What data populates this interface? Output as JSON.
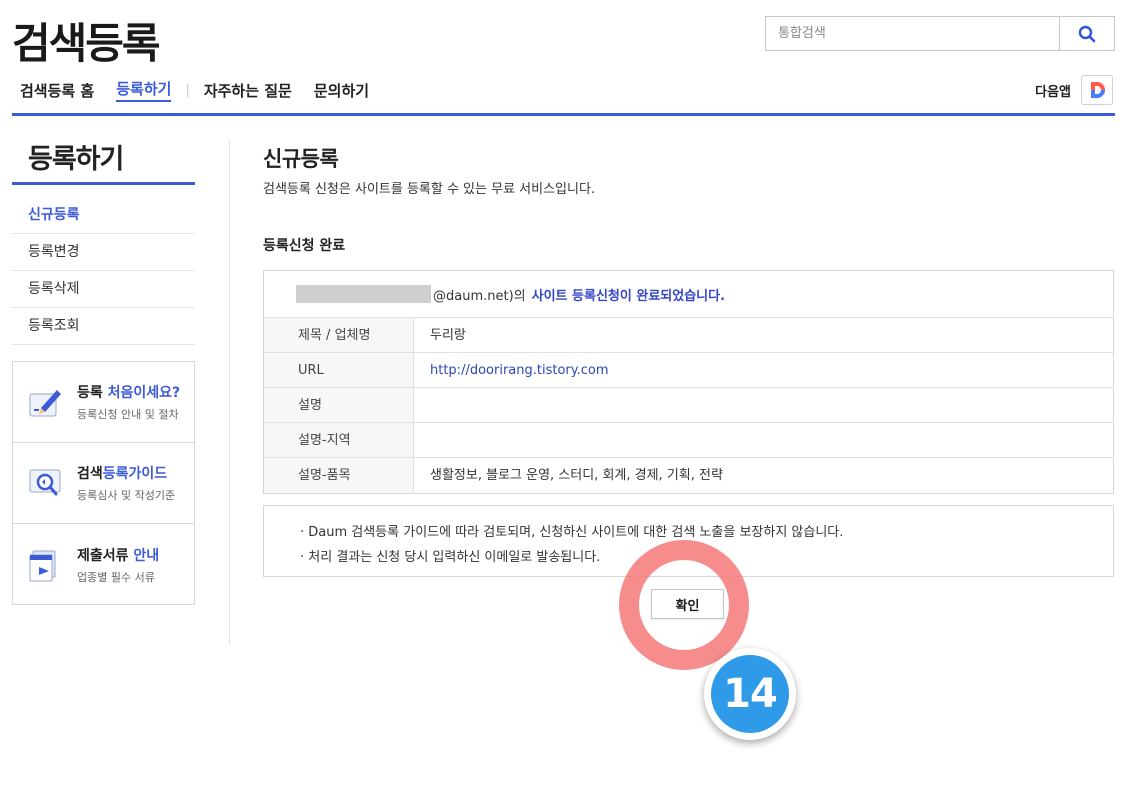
{
  "header": {
    "logo": "검색등록",
    "search_placeholder": "통합검색"
  },
  "topnav": {
    "home": "검색등록 홈",
    "register": "등록하기",
    "faq": "자주하는 질문",
    "contact": "문의하기",
    "daum_app": "다음앱"
  },
  "sidebar": {
    "title": "등록하기",
    "items": [
      {
        "label": "신규등록"
      },
      {
        "label": "등록변경"
      },
      {
        "label": "등록삭제"
      },
      {
        "label": "등록조회"
      }
    ],
    "cards": [
      {
        "title_a": "등록 ",
        "title_b": "처음이세요?",
        "sub": "등록신청 안내 및 절차",
        "icon": "pencil-icon"
      },
      {
        "title_a": "검색",
        "title_b": "등록가이드",
        "sub": "등록심사 및 작성기준",
        "icon": "magnifier-guide-icon"
      },
      {
        "title_a": "제출서류 ",
        "title_b": "안내",
        "sub": "업종별 필수 서류",
        "icon": "documents-icon"
      }
    ]
  },
  "main": {
    "title": "신규등록",
    "desc": "검색등록 신청은 사이트를 등록할 수 있는 무료 서비스입니다.",
    "section_title": "등록신청 완료",
    "result_email_suffix": "@daum.net)의",
    "result_done": "사이트 등록신청이 완료되었습니다.",
    "rows": [
      {
        "label": "제목 / 업체명",
        "value": "두리랑"
      },
      {
        "label": "URL",
        "value": "http://doorirang.tistory.com"
      },
      {
        "label": "설명",
        "value": ""
      },
      {
        "label": "설명-지역",
        "value": ""
      },
      {
        "label": "설명-품목",
        "value": "생활정보, 블로그 운영, 스터디, 회계, 경제, 기획, 전략"
      }
    ],
    "notices": [
      "· Daum 검색등록 가이드에 따라 검토되며, 신청하신 사이트에 대한 검색 노출을 보장하지 않습니다.",
      "· 처리 결과는 신청 당시 입력하신 이메일로 발송됩니다."
    ],
    "confirm": "확인"
  },
  "annotation": {
    "step": "14"
  },
  "colors": {
    "accent": "#3d5bd6",
    "highlight_ring": "#f67878",
    "badge": "#2f9ae8"
  }
}
